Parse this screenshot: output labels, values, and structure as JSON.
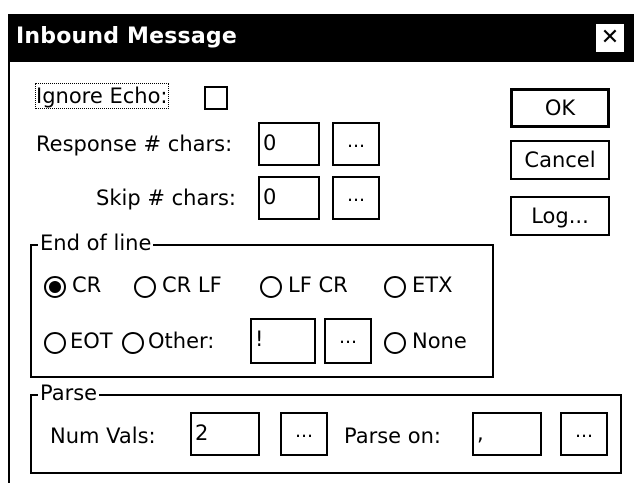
{
  "window": {
    "title": "Inbound Message",
    "close_glyph": "✕"
  },
  "fields": {
    "ignore_echo_label": "Ignore Echo:",
    "ignore_echo_checked": false,
    "response_chars_label": "Response # chars:",
    "response_chars_value": "0",
    "skip_chars_label": "Skip # chars:",
    "skip_chars_value": "0",
    "ellipsis": "..."
  },
  "buttons": {
    "ok": "OK",
    "cancel": "Cancel",
    "log": "Log..."
  },
  "end_of_line": {
    "group_label": "End of line",
    "options": [
      {
        "label": "CR",
        "selected": true
      },
      {
        "label": "CR LF",
        "selected": false
      },
      {
        "label": "LF CR",
        "selected": false
      },
      {
        "label": "ETX",
        "selected": false
      },
      {
        "label": "EOT",
        "selected": false
      },
      {
        "label": "Other:",
        "selected": false
      },
      {
        "label": "None",
        "selected": false
      }
    ],
    "other_value": "!"
  },
  "parse": {
    "group_label": "Parse",
    "num_vals_label": "Num Vals:",
    "num_vals_value": "2",
    "parse_on_label": "Parse on:",
    "parse_on_value": ","
  }
}
